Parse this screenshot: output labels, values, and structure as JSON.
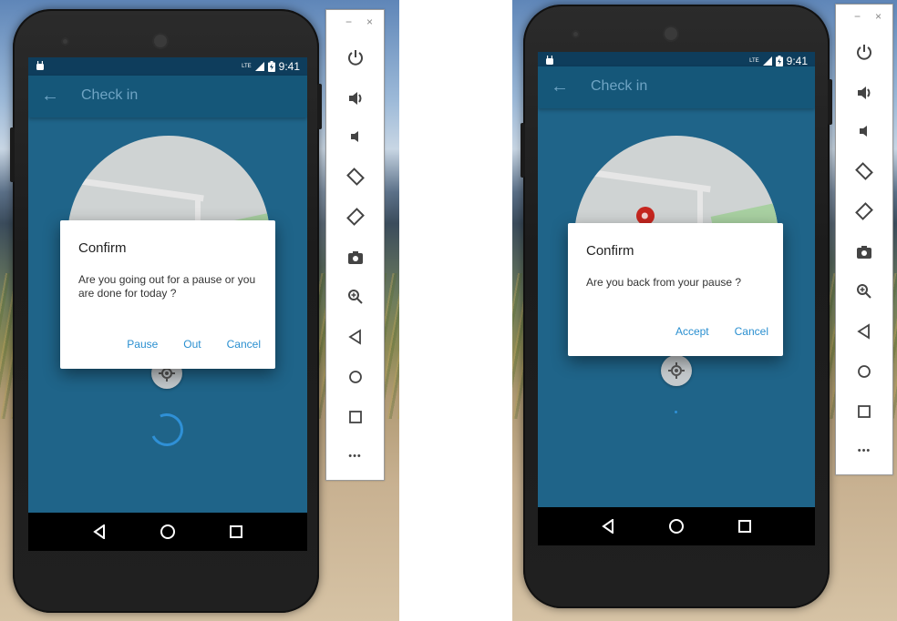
{
  "left_panel": {
    "status": {
      "network": "LTE",
      "time": "9:41"
    },
    "appbar": {
      "back_icon": "arrow-back-icon",
      "title": "Check in"
    },
    "dialog": {
      "title": "Confirm",
      "message": "Are you going out for a pause or you are done for today ?",
      "actions": [
        "Pause",
        "Out",
        "Cancel"
      ]
    }
  },
  "right_panel": {
    "status": {
      "network": "LTE",
      "time": "9:41"
    },
    "appbar": {
      "back_icon": "arrow-back-icon",
      "title": "Check in"
    },
    "dialog": {
      "title": "Confirm",
      "message": "Are you back from your pause ?",
      "actions": [
        "Accept",
        "Cancel"
      ]
    }
  },
  "emulator_toolbar": {
    "window_controls": {
      "minimize": "−",
      "close": "×"
    },
    "buttons": [
      "power-icon",
      "volume-up-icon",
      "volume-down-icon",
      "rotate-left-icon",
      "rotate-right-icon",
      "camera-icon",
      "zoom-icon",
      "back-icon",
      "home-icon",
      "overview-icon",
      "more-icon"
    ],
    "more_label": "•••"
  },
  "colors": {
    "screen_bg": "#1f6489",
    "appbar_bg": "#155779",
    "accent": "#2a8fd0",
    "pin": "#c6261f"
  }
}
